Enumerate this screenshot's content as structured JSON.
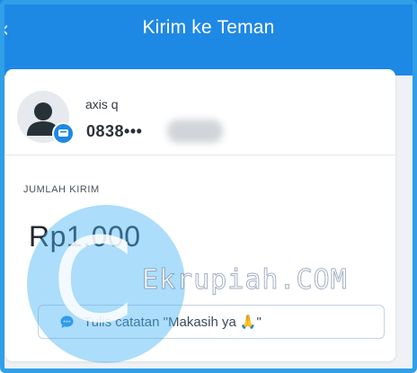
{
  "header": {
    "back_icon": "‹",
    "title": "Kirim ke Teman"
  },
  "recipient": {
    "name": "axis q",
    "phone_prefix": "0838•••"
  },
  "transfer": {
    "amount_label": "JUMLAH KIRIM",
    "amount": "Rp1.000"
  },
  "note": {
    "placeholder": "Tulis catatan \"Makasih ya",
    "emoji": "🙏",
    "closing_quote": "\""
  },
  "watermark": {
    "letter": "C",
    "text": "Ekrupiah.COM"
  },
  "colors": {
    "header_bg": "#1e88e5",
    "frame_border": "#2f9fe8",
    "accent": "#1e88e5"
  }
}
